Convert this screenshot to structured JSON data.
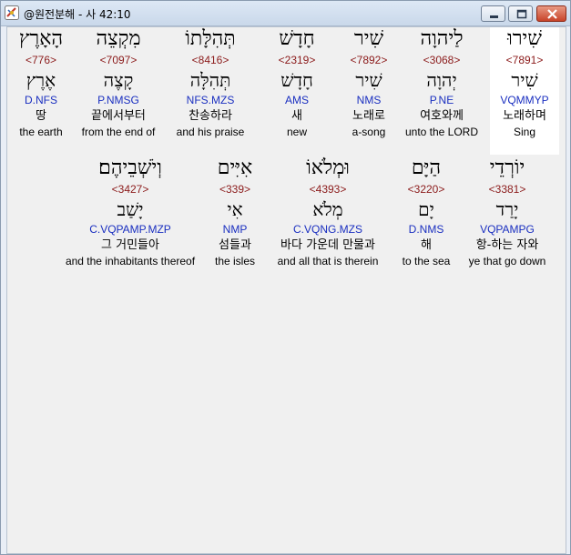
{
  "window": {
    "title": "@원전분해 - 사 42:10"
  },
  "rows": [
    [
      {
        "hebrew": "שִׁירוּ",
        "strong": "<7891>",
        "lemma": "שִׁיר",
        "parse": "VQMMYP",
        "korean": "노래하며",
        "english": "Sing",
        "highlight": true
      },
      {
        "hebrew": "לַיהוָה",
        "strong": "<3068>",
        "lemma": "יְהוָה",
        "parse": "P.NE",
        "korean": "여호와께",
        "english": "unto the LORD"
      },
      {
        "hebrew": "שִׁיר",
        "strong": "<7892>",
        "lemma": "שִׁיר",
        "parse": "NMS",
        "korean": "노래로",
        "english": "a-song"
      },
      {
        "hebrew": "חָדָשׁ",
        "strong": "<2319>",
        "lemma": "חָדָשׁ",
        "parse": "AMS",
        "korean": "새",
        "english": "new"
      },
      {
        "hebrew": "תְּהִלָּתוֹ",
        "strong": "<8416>",
        "lemma": "תְּהִלָּה",
        "parse": "NFS.MZS",
        "korean": "찬송하라",
        "english": "and his praise"
      },
      {
        "hebrew": "מִקְצֵה",
        "strong": "<7097>",
        "lemma": "קָצֶה",
        "parse": "P.NMSG",
        "korean": "끝에서부터",
        "english": "from the end of"
      },
      {
        "hebrew": "הָאָרֶץ",
        "strong": "<776>",
        "lemma": "אֶרֶץ",
        "parse": "D.NFS",
        "korean": "땅",
        "english": "the earth"
      }
    ],
    [
      {
        "hebrew": "יוֹרְדֵי",
        "strong": "<3381>",
        "lemma": "יָרַד",
        "parse": "VQPAMPG",
        "korean": "항-하는 자와",
        "english": "ye that go down"
      },
      {
        "hebrew": "הַיָּם",
        "strong": "<3220>",
        "lemma": "יָם",
        "parse": "D.NMS",
        "korean": "해",
        "english": "to the sea"
      },
      {
        "hebrew": "וּמְלֹאוֹ",
        "strong": "<4393>",
        "lemma": "מְלֹא",
        "parse": "C.VQNG.MZS",
        "korean": "바다 가운데 만물과",
        "english": "and all that is therein"
      },
      {
        "hebrew": "אִיִּים",
        "strong": "<339>",
        "lemma": "אִי",
        "parse": "NMP",
        "korean": "섬들과",
        "english": "the isles"
      },
      {
        "hebrew": "וְיֹשְׁבֵיהֶם׃",
        "strong": "<3427>",
        "lemma": "יָשַׁב",
        "parse": "C.VQPAMP.MZP",
        "korean": "그 거민들아",
        "english": "and the inhabitants thereof"
      }
    ]
  ]
}
